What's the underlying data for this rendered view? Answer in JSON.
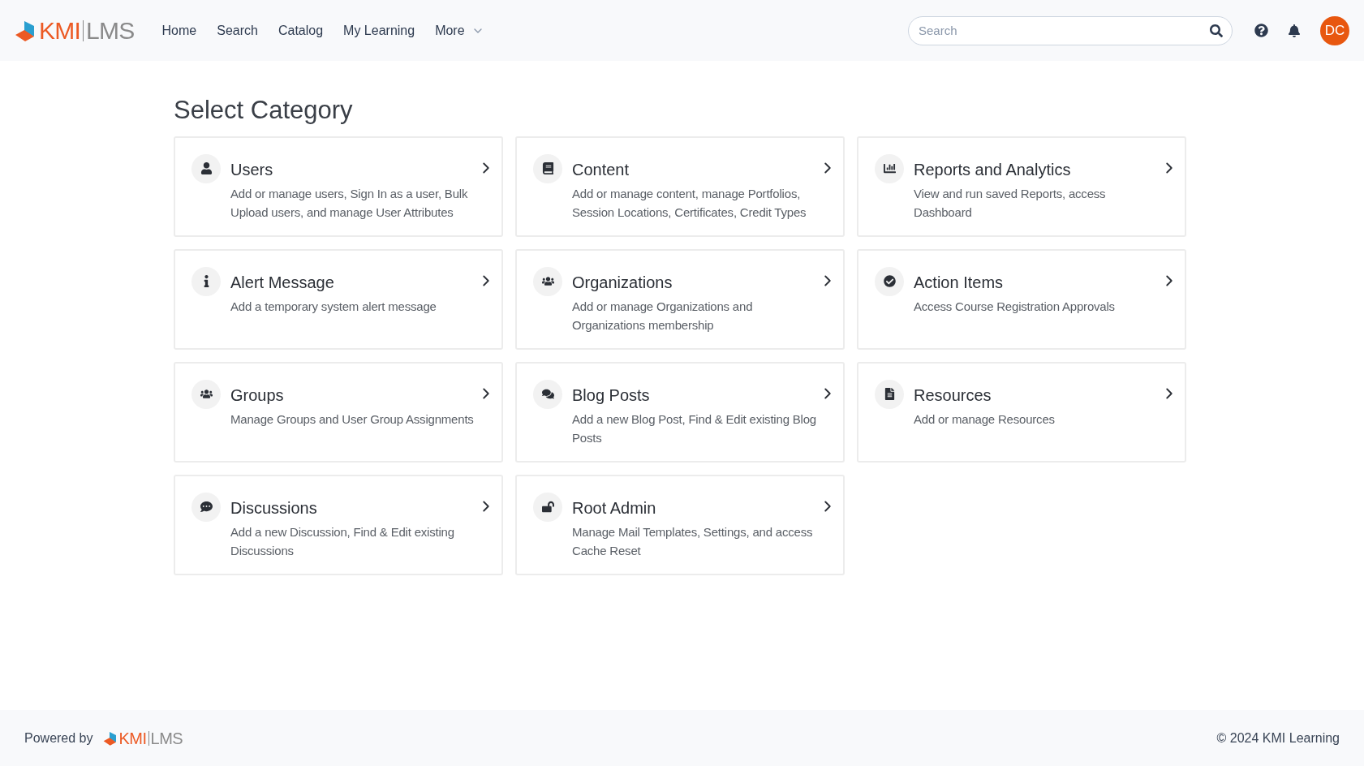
{
  "header": {
    "logo": {
      "brand": "KMI",
      "product": "LMS"
    },
    "nav": [
      {
        "label": "Home",
        "has_menu": false
      },
      {
        "label": "Search",
        "has_menu": false
      },
      {
        "label": "Catalog",
        "has_menu": false
      },
      {
        "label": "My Learning",
        "has_menu": false
      },
      {
        "label": "More",
        "has_menu": true
      }
    ],
    "search": {
      "placeholder": "Search"
    },
    "avatar": {
      "initials": "DC"
    }
  },
  "page": {
    "title": "Select Category",
    "categories": [
      {
        "kind": "user",
        "title": "Users",
        "description": "Add or manage users, Sign In as a user, Bulk Upload users, and manage User Attributes"
      },
      {
        "kind": "book",
        "title": "Content",
        "description": "Add or manage content, manage Portfolios, Session Locations, Certificates, Credit Types"
      },
      {
        "kind": "chart",
        "title": "Reports and Analytics",
        "description": "View and run saved Reports, access Dashboard"
      },
      {
        "kind": "info",
        "title": "Alert Message",
        "description": "Add a temporary system alert message"
      },
      {
        "kind": "people",
        "title": "Organizations",
        "description": "Add or manage Organizations and Organizations membership"
      },
      {
        "kind": "check",
        "title": "Action Items",
        "description": "Access Course Registration Approvals"
      },
      {
        "kind": "people",
        "title": "Groups",
        "description": "Manage Groups and User Group Assignments"
      },
      {
        "kind": "comments",
        "title": "Blog Posts",
        "description": "Add a new Blog Post, Find & Edit existing Blog Posts"
      },
      {
        "kind": "file",
        "title": "Resources",
        "description": "Add or manage Resources"
      },
      {
        "kind": "comment",
        "title": "Discussions",
        "description": "Add a new Discussion, Find & Edit existing Discussions"
      },
      {
        "kind": "lock",
        "title": "Root Admin",
        "description": "Manage Mail Templates, Settings, and access Cache Reset"
      }
    ]
  },
  "footer": {
    "powered_by": "Powered by",
    "logo": {
      "brand": "KMI",
      "product": "LMS"
    },
    "copyright": "© 2024 KMI Learning"
  }
}
